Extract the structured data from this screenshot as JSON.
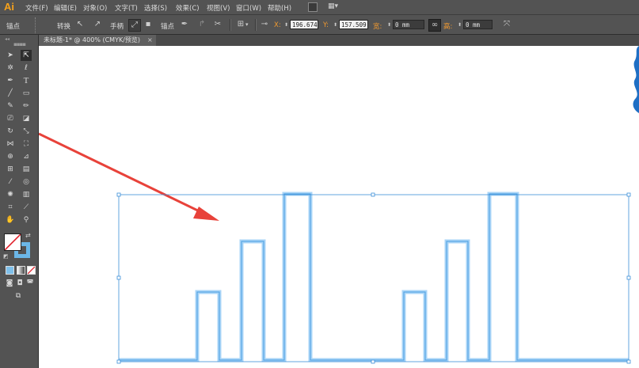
{
  "app": {
    "logo": "Ai"
  },
  "menu": [
    "文件(F)",
    "编辑(E)",
    "对象(O)",
    "文字(T)",
    "选择(S)",
    "效果(C)",
    "视图(V)",
    "窗口(W)",
    "帮助(H)"
  ],
  "control": {
    "anchor_label": "锚点",
    "convert_label": "转换",
    "handle_label": "手柄",
    "anchor_label2": "锚点",
    "x_label": "X:",
    "x_value": "196.674",
    "y_label": "Y:",
    "y_value": "157.509",
    "w_label": "宽:",
    "w_value": "0 mm",
    "h_label": "高:",
    "h_value": "0 mm"
  },
  "tab": {
    "title": "未标题-1* @ 400% (CMYK/预览)",
    "close": "×"
  },
  "colors": {
    "accent": "#f19a2f",
    "selection": "#3c8fd8",
    "path_glow": "#a8d4f7",
    "arrow": "#e8423a",
    "bg": "#535353",
    "canvas": "#ffffff"
  }
}
